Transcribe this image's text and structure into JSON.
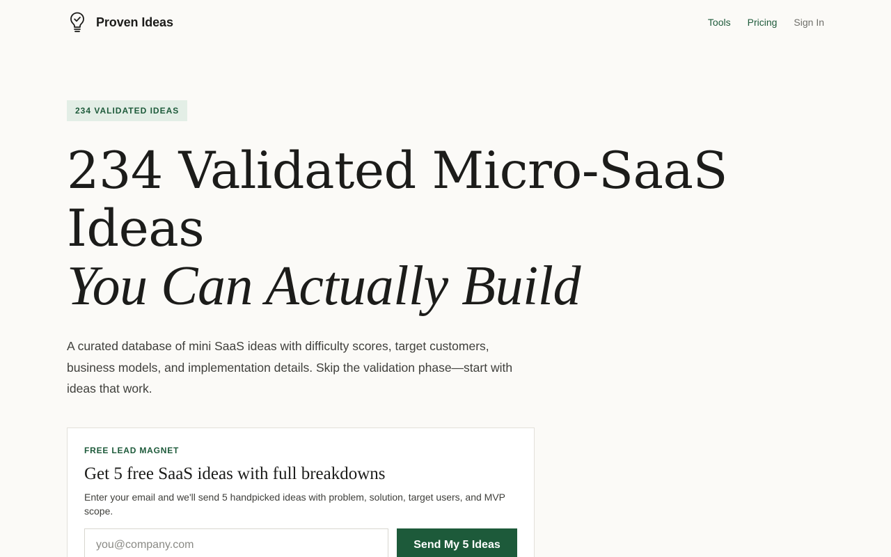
{
  "header": {
    "brand_name": "Proven Ideas",
    "brand_icon": "lightbulb-check-icon",
    "nav": [
      {
        "label": "Tools"
      },
      {
        "label": "Pricing"
      },
      {
        "label": "Sign In"
      }
    ]
  },
  "hero": {
    "badge": "234 VALIDATED IDEAS",
    "title_line1": "234 Validated Micro-SaaS",
    "title_line2": "Ideas",
    "title_line3": "You Can Actually Build",
    "description": "A curated database of mini SaaS ideas with difficulty scores, target customers, business models, and implementation details. Skip the validation phase—start with ideas that work."
  },
  "lead_magnet": {
    "eyebrow": "FREE LEAD MAGNET",
    "title": "Get 5 free SaaS ideas with full breakdowns",
    "description": "Enter your email and we'll send 5 handpicked ideas with problem, solution, target users, and MVP scope.",
    "email_placeholder": "you@company.com",
    "email_value": "",
    "submit_label": "Send My 5 Ideas"
  },
  "colors": {
    "background": "#fbfaf7",
    "accent": "#1d5a3a",
    "badge_bg": "#e3eee6",
    "text": "#1c1c1a"
  }
}
